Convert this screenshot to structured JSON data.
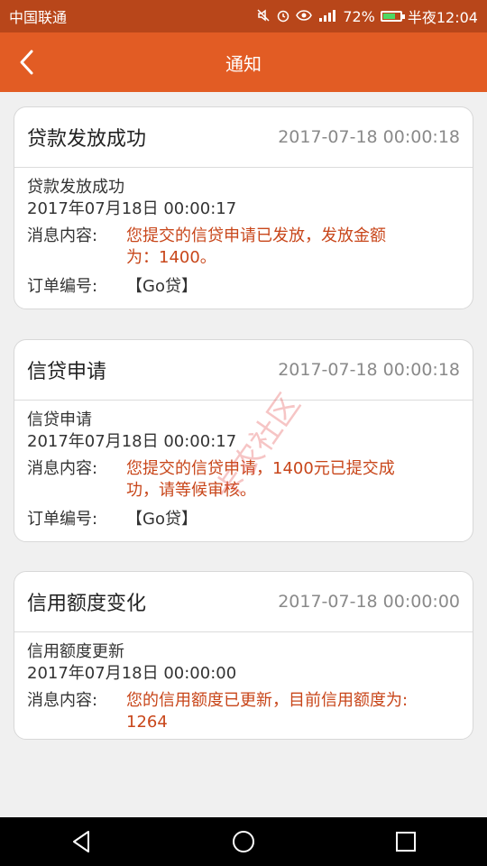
{
  "status_bar": {
    "carrier": "中国联通",
    "battery_percent": "72%",
    "time": "半夜12:04",
    "battery_level": 0.72
  },
  "header": {
    "title": "通知",
    "back_icon": "chevron-left-icon"
  },
  "notifications": [
    {
      "title": "贷款发放成功",
      "time": "2017-07-18 00:00:18",
      "subtitle": "贷款发放成功",
      "datetime": "2017年07月18日 00:00:17",
      "content_label": "消息内容:",
      "content_line1": "您提交的信贷申请已发放，发放金额",
      "content_line2": "为：1400。",
      "order_label": "订单编号:",
      "order_value": "【Go贷】"
    },
    {
      "title": "信贷申请",
      "time": "2017-07-18 00:00:18",
      "subtitle": "信贷申请",
      "datetime": "2017年07月18日 00:00:17",
      "content_label": "消息内容:",
      "content_line1": "您提交的信贷申请，1400元已提交成",
      "content_line2": "功，请等候审核。",
      "order_label": "订单编号:",
      "order_value": "【Go贷】"
    },
    {
      "title": "信用额度变化",
      "time": "2017-07-18 00:00:00",
      "subtitle": "信用额度更新",
      "datetime": "2017年07月18日 00:00:00",
      "content_label": "消息内容:",
      "content_line1": "您的信用额度已更新，目前信用额度为:",
      "content_line2": "1264"
    }
  ],
  "watermark": {
    "text": "卡农社区"
  },
  "nav": {
    "back_icon": "triangle-back-icon",
    "home_icon": "circle-home-icon",
    "recents_icon": "square-recents-icon"
  },
  "colors": {
    "app_bar": "#e25c24",
    "status_bar": "#b8461a",
    "accent_text": "#c8461a"
  }
}
